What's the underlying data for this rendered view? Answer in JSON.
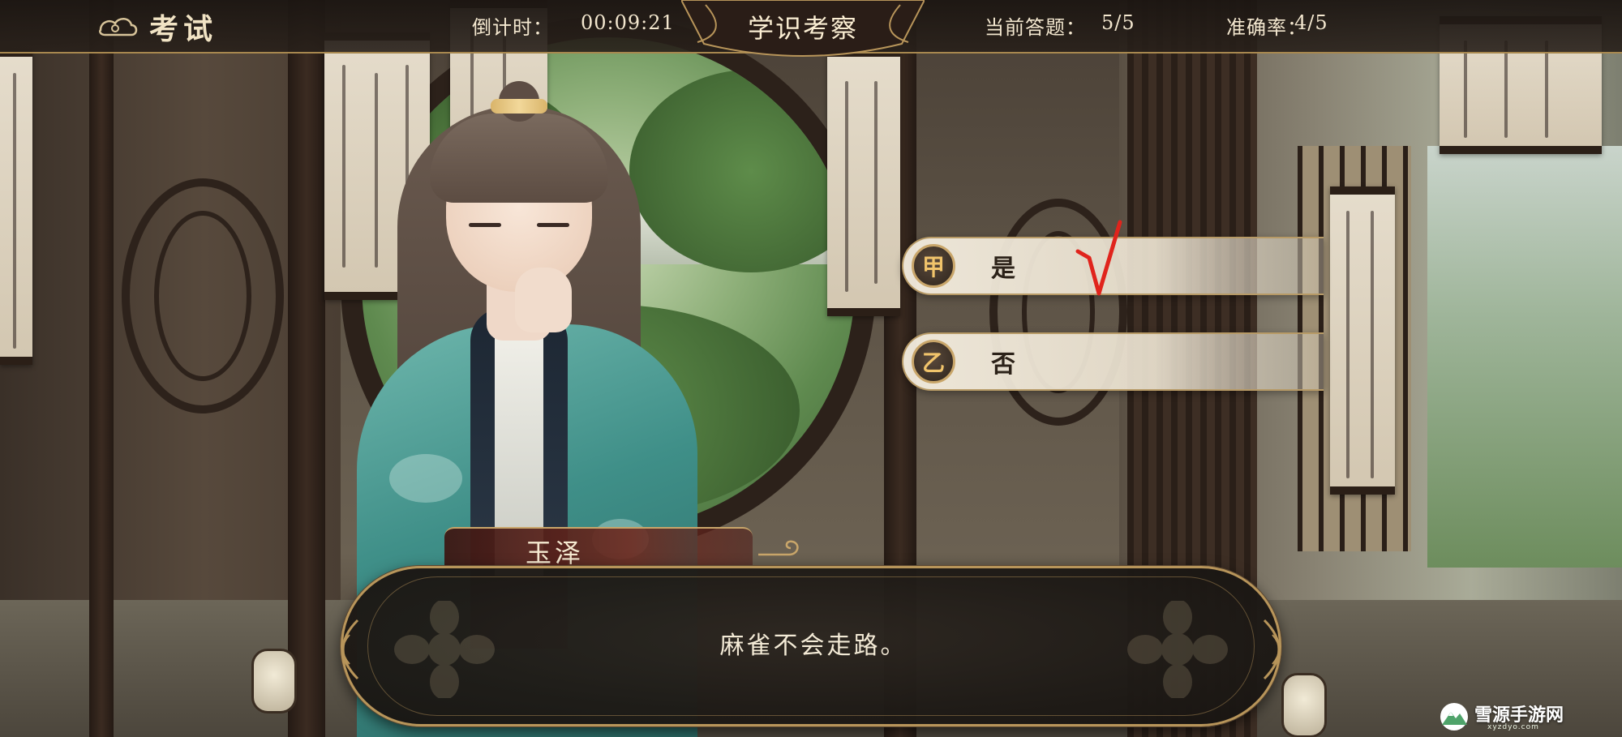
{
  "header": {
    "title": "考试",
    "countdown_label": "倒计时：",
    "countdown_value": "00:09:21",
    "banner_title": "学识考察",
    "question_label": "当前答题：",
    "question_value": "5/5",
    "accuracy_label": "准确率：",
    "accuracy_value": "4/5"
  },
  "options": [
    {
      "badge": "甲",
      "label": "是",
      "marked_correct": true
    },
    {
      "badge": "乙",
      "label": "否",
      "marked_correct": false
    }
  ],
  "check_mark": "√",
  "dialogue": {
    "speaker": "玉泽",
    "text": "麻雀不会走路。"
  },
  "watermark": {
    "text": "雪源手游网",
    "sub": "xyzdyo.com"
  },
  "colors": {
    "accent_gold": "#b8955a",
    "option_badge_text": "#f1c46b",
    "check_mark": "#e0241c",
    "dialogue_text": "#f3ead6"
  },
  "icons": {
    "back": "cloud-swirl-icon",
    "check": "check-mark-icon"
  }
}
